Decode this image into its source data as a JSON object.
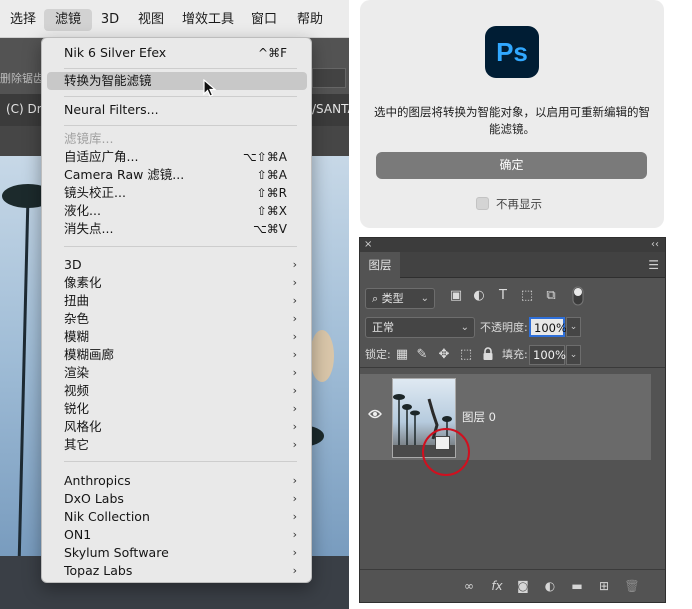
{
  "menubar": {
    "items": [
      "选择",
      "滤镜",
      "3D",
      "视图",
      "增效工具",
      "窗口",
      "帮助"
    ]
  },
  "optionsbar": {
    "left_label": "删除锯齿"
  },
  "document_tab": {
    "left_text": "(C) Dr",
    "right_text": "/SANTA"
  },
  "filter_menu": {
    "recent": {
      "label": "Nik 6 Silver Efex",
      "shortcut": "^⌘F"
    },
    "convert_smart": "转换为智能滤镜",
    "neural": "Neural Filters...",
    "gallery": "滤镜库...",
    "adaptive_wide": {
      "label": "自适应广角...",
      "shortcut": "⌥⇧⌘A"
    },
    "camera_raw": {
      "label": "Camera Raw 滤镜...",
      "shortcut": "⇧⌘A"
    },
    "lens": {
      "label": "镜头校正...",
      "shortcut": "⇧⌘R"
    },
    "liquify": {
      "label": "液化...",
      "shortcut": "⇧⌘X"
    },
    "vanishing": {
      "label": "消失点...",
      "shortcut": "⌥⌘V"
    },
    "submenus": [
      "3D",
      "像素化",
      "扭曲",
      "杂色",
      "模糊",
      "模糊画廊",
      "渲染",
      "视频",
      "锐化",
      "风格化",
      "其它"
    ],
    "plugins": [
      "Anthropics",
      "DxO Labs",
      "Nik Collection",
      "ON1",
      "Skylum Software",
      "Topaz Labs"
    ],
    "arrow_glyph": "›"
  },
  "dialog": {
    "logo_text": "Ps",
    "message": "选中的图层将转换为智能对象，以启用可重新编辑的智能滤镜。",
    "ok_label": "确定",
    "dont_show": "不再显示"
  },
  "layers_panel": {
    "close_glyph": "×",
    "collapse_glyph": "‹‹",
    "tab": "图层",
    "menu_glyph": "☰",
    "filter_type": "类型",
    "blend_mode": "正常",
    "opacity_label": "不透明度:",
    "opacity_value": "100%",
    "lock_label": "锁定:",
    "fill_label": "填充:",
    "fill_value": "100%",
    "layer_name": "图层 0",
    "fx_label": "fx"
  }
}
